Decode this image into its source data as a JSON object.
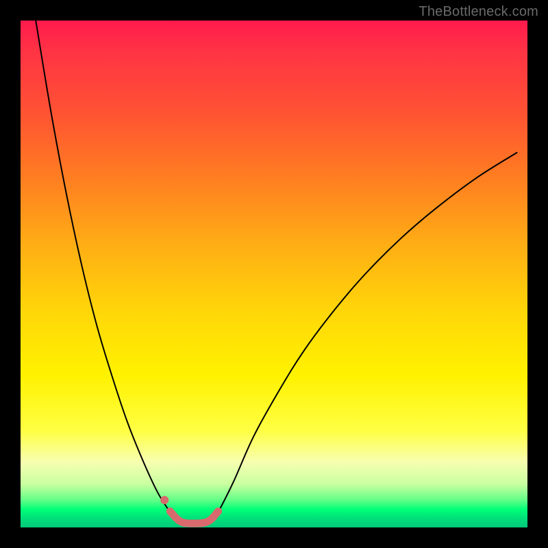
{
  "watermark": "TheBottleneck.com",
  "chart_data": {
    "type": "line",
    "title": "",
    "xlabel": "",
    "ylabel": "",
    "xlim": [
      0,
      100
    ],
    "ylim": [
      0,
      100
    ],
    "grid": false,
    "legend": false,
    "annotations": [],
    "gradient_stops": [
      {
        "pos": 0,
        "color": "#ff1a4d"
      },
      {
        "pos": 30,
        "color": "#ff7a22"
      },
      {
        "pos": 58,
        "color": "#ffd808"
      },
      {
        "pos": 81,
        "color": "#ffff44"
      },
      {
        "pos": 96,
        "color": "#00ff77"
      },
      {
        "pos": 100,
        "color": "#00c979"
      }
    ],
    "series": [
      {
        "name": "left-curve",
        "color": "#000000",
        "width": 2,
        "x": [
          3,
          6,
          9,
          12,
          15,
          18,
          21,
          24,
          27,
          29.5
        ],
        "y": [
          100,
          82,
          66,
          52,
          40,
          30,
          21,
          13.5,
          7,
          3
        ]
      },
      {
        "name": "right-curve",
        "color": "#000000",
        "width": 2,
        "x": [
          39,
          42,
          46,
          51,
          56,
          62,
          68,
          75,
          82,
          90,
          98
        ],
        "y": [
          3,
          9,
          18,
          27,
          35,
          43,
          50,
          57,
          63,
          69,
          74
        ]
      },
      {
        "name": "valley-highlight",
        "color": "#d86a6e",
        "width": 11,
        "linecap": "round",
        "x": [
          29.5,
          31.5,
          34,
          37,
          39
        ],
        "y": [
          3.2,
          1.2,
          0.8,
          1.2,
          3.2
        ]
      },
      {
        "name": "valley-dot",
        "type": "scatter",
        "color": "#d86a6e",
        "radius": 6,
        "x": [
          28.4
        ],
        "y": [
          5.4
        ]
      }
    ]
  }
}
